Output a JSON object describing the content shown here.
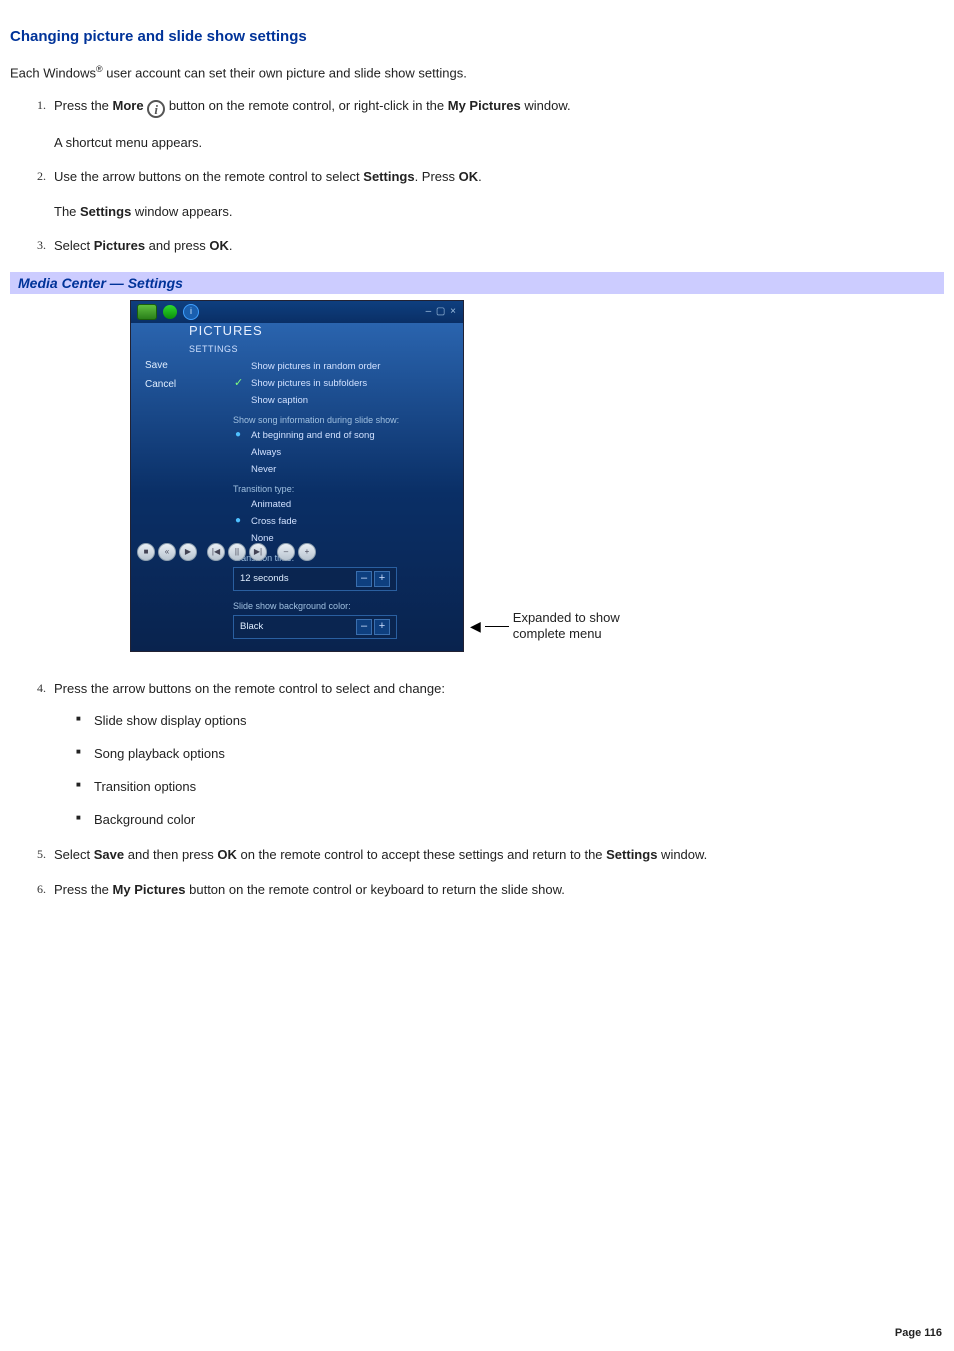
{
  "title": "Changing picture and slide show settings",
  "intro_pre": "Each Windows",
  "intro_sup": "®",
  "intro_post": " user account can set their own picture and slide show settings.",
  "steps": {
    "s1a": "Press the ",
    "s1b": "More",
    "s1c": " button on the remote control, or right-click in the ",
    "s1d": "My Pictures",
    "s1e": " window.",
    "s1sub": "A shortcut menu appears.",
    "s2a": "Use the arrow buttons on the remote control to select ",
    "s2b": "Settings",
    "s2c": ". Press ",
    "s2d": "OK",
    "s2e": ".",
    "s2sub_a": "The ",
    "s2sub_b": "Settings",
    "s2sub_c": " window appears.",
    "s3a": "Select ",
    "s3b": "Pictures",
    "s3c": " and press ",
    "s3d": "OK",
    "s3e": ".",
    "s4": "Press the arrow buttons on the remote control to select and change:",
    "s4_b1": "Slide show display options",
    "s4_b2": "Song playback options",
    "s4_b3": "Transition options",
    "s4_b4": "Background color",
    "s5a": "Select ",
    "s5b": "Save",
    "s5c": " and then press ",
    "s5d": "OK",
    "s5e": " on the remote control to accept these settings and return to the ",
    "s5f": "Settings",
    "s5g": " window.",
    "s6a": "Press the ",
    "s6b": "My Pictures",
    "s6c": " button on the remote control or keyboard to return the slide show."
  },
  "banner": "Media Center — Settings",
  "annot1": "Expanded to show",
  "annot2": "complete menu",
  "footer": "Page 116",
  "shot": {
    "winctrls": "– ▢ ×",
    "crumb": "SETTINGS",
    "screen": "PICTURES",
    "save": "Save",
    "cancel": "Cancel",
    "opt_random": "Show pictures in random order",
    "opt_subfolders": "Show pictures in subfolders",
    "opt_caption": "Show caption",
    "grp_song": "Show song information during slide show:",
    "song_begend": "At beginning and end of song",
    "song_always": "Always",
    "song_never": "Never",
    "grp_trans": "Transition type:",
    "trans_anim": "Animated",
    "trans_cross": "Cross fade",
    "trans_none": "None",
    "grp_time": "Transition time:",
    "time_val": "12 seconds",
    "grp_bg": "Slide show background color:",
    "bg_val": "Black"
  }
}
